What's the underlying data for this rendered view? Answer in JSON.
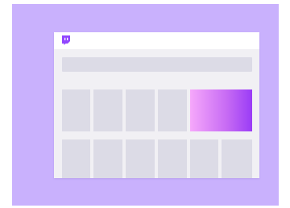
{
  "app": {
    "logo_icon": "twitch-icon",
    "brand_color": "#9146ff"
  },
  "colors": {
    "background_panel": "#c9b1fd",
    "window_body": "#f1f0f4",
    "placeholder": "#dcdbe6",
    "featured_gradient": [
      "#f6a8fb",
      "#9a3cf6"
    ]
  },
  "content": {
    "row1_tiles": 4,
    "row2_tiles": 6,
    "has_featured_tile": true
  }
}
